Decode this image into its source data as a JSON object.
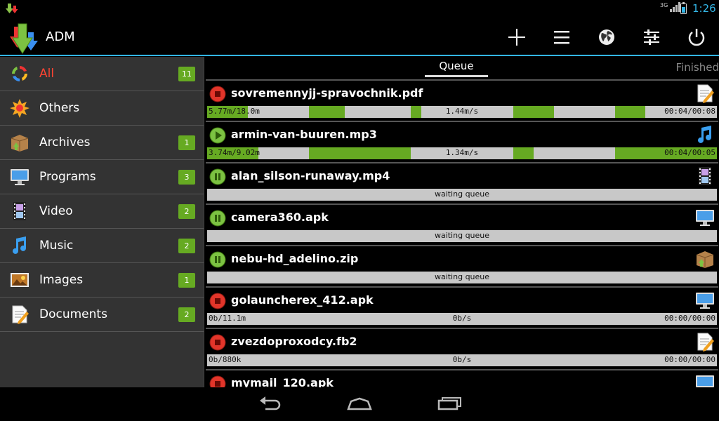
{
  "status_bar": {
    "time": "1:26",
    "signal_label": "3G"
  },
  "app": {
    "title": "ADM"
  },
  "toolbar": [
    {
      "name": "add-icon"
    },
    {
      "name": "menu-icon"
    },
    {
      "name": "browser-globe-icon"
    },
    {
      "name": "settings-sliders-icon"
    },
    {
      "name": "power-icon"
    }
  ],
  "sidebar": {
    "items": [
      {
        "label": "All",
        "count": "11",
        "icon": "all-refresh-icon",
        "active": true
      },
      {
        "label": "Others",
        "count": "",
        "icon": "others-burst-icon"
      },
      {
        "label": "Archives",
        "count": "1",
        "icon": "archive-box-icon"
      },
      {
        "label": "Programs",
        "count": "3",
        "icon": "monitor-icon"
      },
      {
        "label": "Video",
        "count": "2",
        "icon": "film-icon"
      },
      {
        "label": "Music",
        "count": "2",
        "icon": "music-note-icon"
      },
      {
        "label": "Images",
        "count": "1",
        "icon": "image-icon"
      },
      {
        "label": "Documents",
        "count": "2",
        "icon": "document-icon"
      }
    ]
  },
  "tabs": {
    "queue": "Queue",
    "finished": "Finished"
  },
  "downloads": [
    {
      "filename": "sovremennyjj-spravochnik.pdf",
      "status": "stopped",
      "type_icon": "document-icon",
      "size": "5.77m/18.0m",
      "speed": "1.44m/s",
      "time": "00:04/00:08",
      "progress": 0.32,
      "segments": [
        [
          0,
          0.08
        ],
        [
          0.2,
          0.27
        ],
        [
          0.4,
          0.42
        ],
        [
          0.6,
          0.68
        ],
        [
          0.8,
          0.86
        ]
      ]
    },
    {
      "filename": "armin-van-buuren.mp3",
      "status": "playing",
      "type_icon": "music-note-icon",
      "size": "3.74m/9.02m",
      "speed": "1.34m/s",
      "time": "00:04/00:05",
      "progress": 0.41,
      "segments": [
        [
          0,
          0.1
        ],
        [
          0.2,
          0.4
        ],
        [
          0.6,
          0.64
        ],
        [
          0.8,
          1
        ]
      ]
    },
    {
      "filename": "alan_silson-runaway.mp4",
      "status": "waiting",
      "type_icon": "film-icon",
      "message": "waiting queue"
    },
    {
      "filename": "camera360.apk",
      "status": "waiting",
      "type_icon": "monitor-icon",
      "message": "waiting queue"
    },
    {
      "filename": "nebu-hd_adelino.zip",
      "status": "waiting",
      "type_icon": "archive-box-icon",
      "message": "waiting queue"
    },
    {
      "filename": "golauncherex_412.apk",
      "status": "stopped",
      "type_icon": "monitor-icon",
      "size": "0b/11.1m",
      "speed": "0b/s",
      "time": "00:00/00:00",
      "progress": 0,
      "segments": []
    },
    {
      "filename": "zvezdoproxodcy.fb2",
      "status": "stopped",
      "type_icon": "document-icon",
      "size": "0b/880k",
      "speed": "0b/s",
      "time": "00:00/00:00",
      "progress": 0,
      "segments": []
    },
    {
      "filename": "mymail_120.apk",
      "status": "stopped",
      "type_icon": "monitor-icon"
    }
  ],
  "nav_bar": [
    {
      "name": "back-icon"
    },
    {
      "name": "home-icon"
    },
    {
      "name": "recent-apps-icon"
    }
  ]
}
